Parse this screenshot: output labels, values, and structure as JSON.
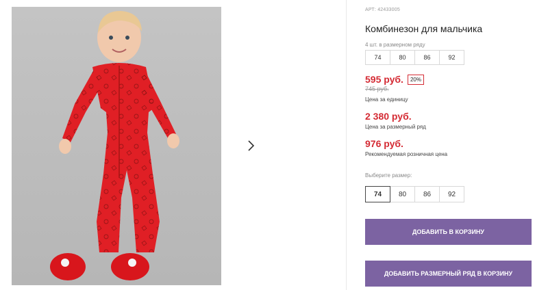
{
  "product": {
    "article": "АРТ: 42433005",
    "title": "Комбинезон для мальчика",
    "pack_note": "4 шт. в размерном ряду",
    "pack_sizes": [
      "74",
      "80",
      "86",
      "92"
    ],
    "price": "595 руб.",
    "discount": "20%",
    "old_price": "745 руб.",
    "price_unit_label": "Цена за единицу",
    "pack_price": "2 380 руб.",
    "pack_price_label": "Цена за размерный ряд",
    "rrp": "976 руб.",
    "rrp_label": "Рекомендуемая розничная цена",
    "choose_label": "Выберите размер:",
    "sizes": [
      "74",
      "80",
      "86",
      "92"
    ],
    "selected_size": "74",
    "add_to_cart": "Добавить в корзину",
    "add_pack_to_cart": "Добавить размерный ряд в корзину"
  },
  "colors": {
    "price_red": "#d42a33",
    "button_purple": "#7c63a2",
    "onesie_red": "#e01f25"
  },
  "icons": {
    "next": "chevron-right-icon"
  }
}
